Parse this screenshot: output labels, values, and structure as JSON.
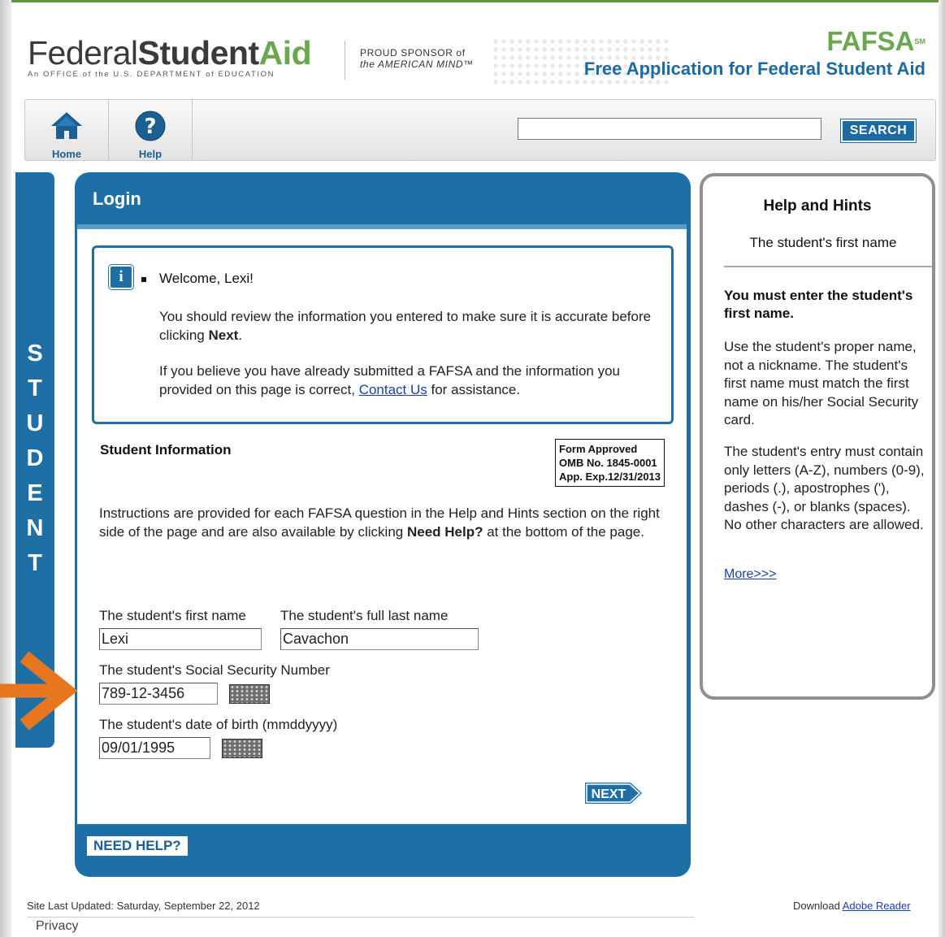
{
  "header": {
    "logo_federal": "Federal",
    "logo_student": "Student",
    "logo_aid": "Aid",
    "logo_tagline": "An OFFICE of the U.S. DEPARTMENT of EDUCATION",
    "sponsor_line1": "PROUD SPONSOR of",
    "sponsor_line2": "the AMERICAN MIND™",
    "fafsa_title": "FAFSA",
    "fafsa_mark": "SM",
    "fafsa_subtitle": "Free Application for Federal Student Aid"
  },
  "nav": {
    "home_label": "Home",
    "help_label": "Help",
    "search_value": "",
    "search_button": "SEARCH"
  },
  "side_tab": {
    "letters": [
      "S",
      "T",
      "U",
      "D",
      "E",
      "N",
      "T"
    ]
  },
  "login": {
    "title": "Login",
    "welcome": "Welcome, Lexi!",
    "info_p1_a": "You should review the information you entered to make sure it is accurate before clicking ",
    "info_p1_b": "Next",
    "info_p1_c": ".",
    "info_p2_a": "If you believe you have already submitted a FAFSA and the information you provided on this page is correct, ",
    "info_p2_link": "Contact Us",
    "info_p2_c": " for assistance.",
    "section_title": "Student Information",
    "omb_line1": "Form Approved",
    "omb_line2": "OMB No. 1845-0001",
    "omb_line3": "App. Exp.12/31/2013",
    "instructions_a": "Instructions are provided for each FAFSA question in the Help and Hints section on the right side of the page and are also available by clicking ",
    "instructions_b": "Need Help?",
    "instructions_c": " at the bottom of the page.",
    "first_name_label": "The student's first name",
    "first_name_value": "Lexi",
    "last_name_label": "The student's full last name",
    "last_name_value": "Cavachon",
    "ssn_label": "The student's Social Security Number",
    "ssn_value": "789-12-3456",
    "dob_label": "The student's date of birth (mmddyyyy)",
    "dob_value": "09/01/1995",
    "next_button": "NEXT",
    "need_help_button": "NEED HELP?"
  },
  "help": {
    "title": "Help and Hints",
    "subtitle": "The student's first name",
    "bold": "You must enter the student's first name.",
    "p1": "Use the student's proper name, not a nickname. The student's first name must match the first name on his/her Social Security card.",
    "p2": "The student's entry must contain only letters (A-Z), numbers (0-9), periods (.), apostrophes ('), dashes (-), or blanks (spaces). No other characters are allowed.",
    "more": "More>>>"
  },
  "footer": {
    "updated": "Site Last Updated: Saturday, September 22, 2012",
    "privacy": "Privacy",
    "download_text": "Download ",
    "download_link": "Adobe Reader"
  },
  "colors": {
    "brand_blue": "#1d6fa6",
    "brand_green": "#6aa84f",
    "annotation_arrow": "#e8761e"
  }
}
